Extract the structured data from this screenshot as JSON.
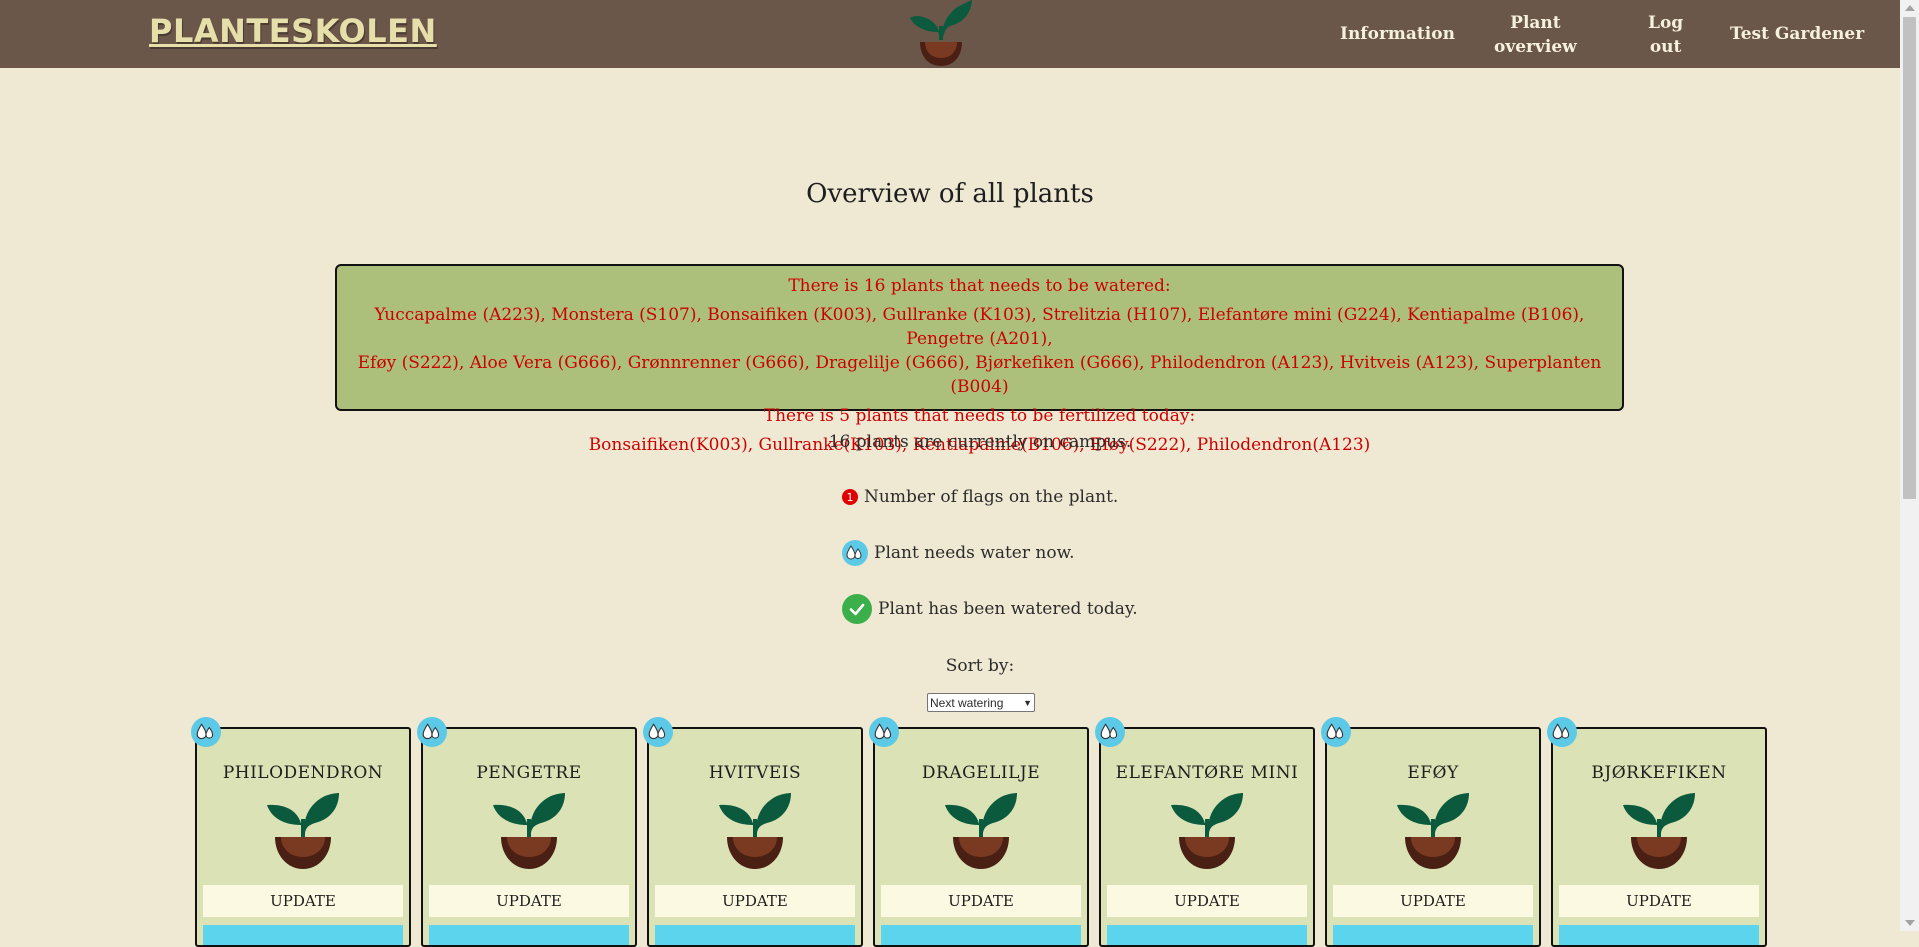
{
  "header": {
    "brand": "PLANTESKOLEN",
    "nav": {
      "information": "Information",
      "plant_overview_line1": "Plant",
      "plant_overview_line2": "overview",
      "logout_line1": "Log",
      "logout_line2": "out",
      "user": "Test Gardener"
    }
  },
  "main": {
    "title": "Overview of all plants",
    "alert": {
      "water_heading": "There is 16 plants that needs to be watered:",
      "water_list_line1": "Yuccapalme (A223), Monstera (S107), Bonsaifiken (K003), Gullranke (K103), Strelitzia (H107), Elefantøre mini (G224), Kentiapalme (B106), Pengetre (A201),",
      "water_list_line2": "Eføy (S222), Aloe Vera (G666), Grønnrenner (G666), Dragelilje (G666), Bjørkefiken (G666), Philodendron (A123), Hvitveis (A123), Superplanten (B004)",
      "fertilize_heading": "There is 5 plants that needs to be fertilized today:",
      "fertilize_list": "Bonsaifiken(K003), Gullranke(K103), Kentiapalme(B106), Eføy(S222), Philodendron(A123)"
    },
    "campus_count": "16 plants are currently on campus.",
    "legend": {
      "flag_number": "1",
      "flag_text": "Number of flags on the plant.",
      "water_text": "Plant needs water now.",
      "watered_text": "Plant has been watered today."
    },
    "sort": {
      "label": "Sort by:",
      "selected": "Next watering"
    },
    "cards": [
      {
        "name": "PHILODENDRON",
        "button": "UPDATE"
      },
      {
        "name": "PENGETRE",
        "button": "UPDATE"
      },
      {
        "name": "HVITVEIS",
        "button": "UPDATE"
      },
      {
        "name": "DRAGELILJE",
        "button": "UPDATE"
      },
      {
        "name": "ELEFANTØRE MINI",
        "button": "UPDATE"
      },
      {
        "name": "EFØY",
        "button": "UPDATE"
      },
      {
        "name": "BJØRKEFIKEN",
        "button": "UPDATE"
      }
    ]
  },
  "colors": {
    "header_bg": "#6b564a",
    "page_bg": "#efe9d3",
    "alert_bg": "#adc07b",
    "alert_text": "#cc0000",
    "card_bg": "#dae2b6",
    "water_blue": "#5cc9e6",
    "check_green": "#3bb04a",
    "leaf_green": "#0b5a3e",
    "pot_brown": "#6b2f1c"
  },
  "icons": [
    "plant-logo-icon",
    "water-drop-icon",
    "check-icon",
    "flag-count-icon",
    "chevron-down-icon"
  ]
}
